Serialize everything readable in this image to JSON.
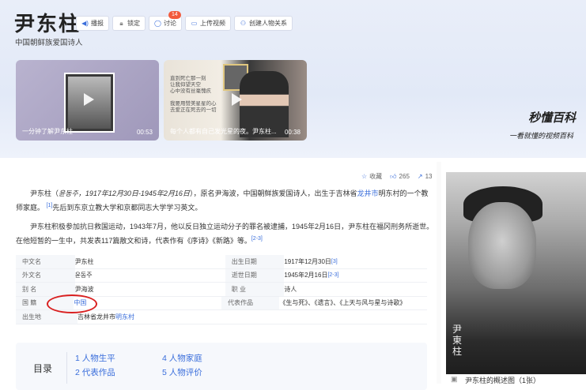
{
  "header": {
    "title": "尹东柱",
    "subtitle": "中国朝鲜族爱国诗人",
    "actions": [
      {
        "label": "播报",
        "icon": "speaker-icon"
      },
      {
        "label": "锁定",
        "icon": "lock-icon"
      },
      {
        "label": "讨论",
        "icon": "chat-icon"
      },
      {
        "label": "上传视频",
        "icon": "video-icon"
      },
      {
        "label": "创建人物关系",
        "icon": "people-icon"
      }
    ],
    "discuss_badge": "14",
    "brand": "秒懂百科",
    "slogan": "一看就懂的视频百科"
  },
  "videos": [
    {
      "caption": "一分钟了解尹东柱",
      "duration": "00:53"
    },
    {
      "caption": "每个人都有自己发光星的夜。尹东柱...",
      "duration": "00:38",
      "poem": [
        "直到死亡那一刻",
        "让我仰望天空",
        "心中没有丝毫愧疚",
        "",
        "我要用赞美星星的心",
        "去爱正在死去的一切"
      ]
    }
  ],
  "stats": {
    "collect": "收藏",
    "likes": "265",
    "shares": "13"
  },
  "intro": {
    "p1_a": "尹东柱（",
    "p1_italic": "윤동주，1917年12月30日-1945年2月16日",
    "p1_b": "），原名尹海波，中国朝鲜族爱国诗人，出生于吉林省",
    "p1_link": "龙井市",
    "p1_c": "明东村的一个教师家庭。",
    "p1_ref": "[1]",
    "p1_d": "先后到东京立教大学和京都同志大学学习英文。",
    "p2": "尹东柱积极参加抗日救国运动，1943年7月，他以反日独立运动分子的罪名被逮捕，1945年2月16日，尹东柱在福冈刑务所逝世。在他短暂的一生中，共发表117篇散文和诗，代表作有《序诗》《新路》等。",
    "p2_ref": "[2-3]"
  },
  "info": {
    "rows": [
      {
        "k1": "中文名",
        "v1": "尹东柱",
        "k2": "出生日期",
        "v2": "1917年12月30日",
        "r2": "[3]"
      },
      {
        "k1": "外文名",
        "v1": "윤동주",
        "k2": "逝世日期",
        "v2": "1945年2月16日",
        "r2": "[2-3]"
      },
      {
        "k1": "别    名",
        "v1": "尹海波",
        "k2": "职    业",
        "v2": "诗人",
        "r2": ""
      },
      {
        "k1": "国    籍",
        "v1": "中国",
        "k2": "代表作品",
        "v2": "《生与死》、《遗言》、《上天与风与星与诗歌》",
        "r2": ""
      },
      {
        "k1": "出生地",
        "v1": "吉林省龙井市",
        "v1_link": "明东村",
        "k2": "",
        "v2": "",
        "r2": ""
      }
    ]
  },
  "toc": {
    "title": "目录",
    "items": [
      "1  人物生平",
      "2  代表作品",
      "4  人物家庭",
      "5  人物评价"
    ]
  },
  "photo": {
    "caption": "尹东柱的概述图（1张）",
    "signature": "尹东柱"
  }
}
